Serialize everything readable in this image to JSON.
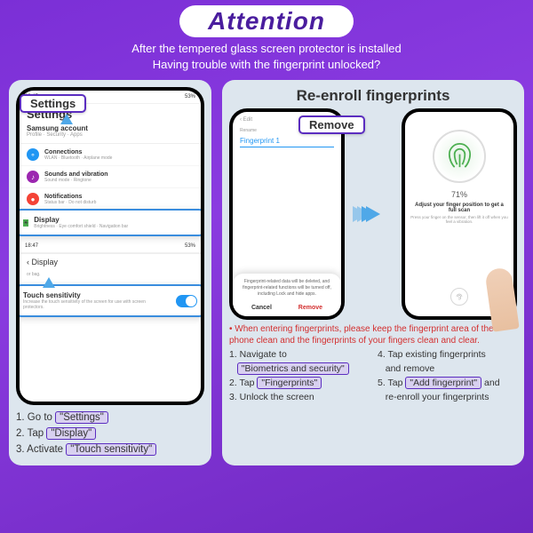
{
  "header": {
    "attention": "Attention",
    "subtitle1": "After the tempered glass screen protector is installed",
    "subtitle2": "Having trouble with the fingerprint unlocked?"
  },
  "left": {
    "statusbar": {
      "time": "18:45",
      "battery": "53%"
    },
    "settings_label": "Settings",
    "samsung": {
      "title": "Samsung account",
      "sub": "Profile · Security · Apps"
    },
    "connections": {
      "title": "Connections",
      "desc": "WLAN · Bluetooth · Airplane mode"
    },
    "sounds": {
      "title": "Sounds and vibration",
      "desc": "Sound mode · Ringtone"
    },
    "notifications": {
      "title": "Notifications",
      "desc": "Status bar · Do not disturb"
    },
    "display": {
      "title": "Display",
      "desc": "Brightness · Eye comfort shield · Navigation bar"
    },
    "sub_statusbar": {
      "time": "18:47",
      "battery": "53%"
    },
    "display_header": "Display",
    "sub_desc": "or bag.",
    "touch": {
      "title": "Touch sensitivity",
      "desc": "Increase the touch sensitivity of the screen for use with screen protectors."
    },
    "instr1a": "1. Go to ",
    "instr1b": "\"Settings\"",
    "instr2a": "2. Tap ",
    "instr2b": "\"Display\"",
    "instr3a": "3. Activate ",
    "instr3b": "\"Touch sensitivity\""
  },
  "right": {
    "title": "Re-enroll fingerprints",
    "remove_label": "Remove",
    "phone1": {
      "edit": "Edit",
      "remove": "Remove",
      "rename": "Rename",
      "fp_name": "Fingerprint 1",
      "dialog_text": "Fingerprint-related data will be deleted, and fingerprint-related functions will be turned off, including Lock and hide apps.",
      "cancel": "Cancel",
      "remove_btn": "Remove"
    },
    "phone2": {
      "percent": "71%",
      "title": "Adjust your finger position to get a full scan",
      "sub": "Press your finger on the sensor, then lift it off when you feel a vibration."
    },
    "red_note": "When entering fingerprints, please keep the fingerprint area of the phone clean and the fingerprints of your fingers clean and clear.",
    "col1": {
      "l1a": "1. Navigate to",
      "l1b": "\"Biometrics and security\"",
      "l2a": "2. Tap ",
      "l2b": "\"Fingerprints\"",
      "l3": "3. Unlock the screen"
    },
    "col2": {
      "l4a": "4. Tap existing fingerprints",
      "l4b": "   and remove",
      "l5a": "5. Tap ",
      "l5b": "\"Add fingerprint\"",
      "l5c": " and",
      "l5d": "   re-enroll your fingerprints"
    }
  }
}
